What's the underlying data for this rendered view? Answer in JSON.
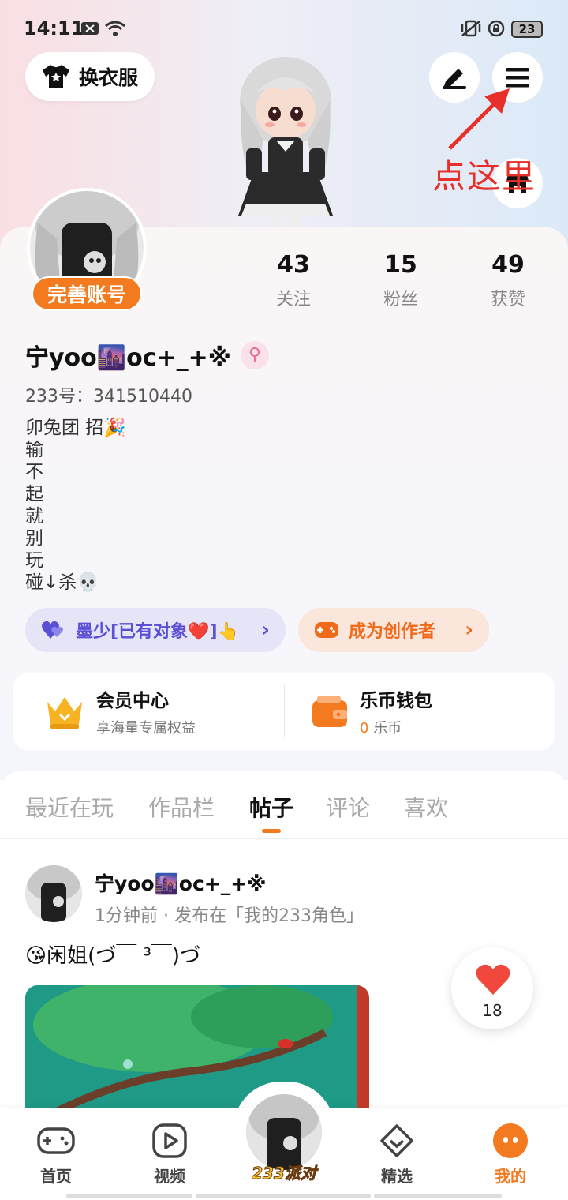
{
  "status_bar": {
    "time": "14:11",
    "battery": "23"
  },
  "header": {
    "outfit_button_label": "换衣服",
    "annotation_text": "点这里"
  },
  "profile": {
    "complete_account_label": "完善账号",
    "stats": [
      {
        "value": "43",
        "label": "关注"
      },
      {
        "value": "15",
        "label": "粉丝"
      },
      {
        "value": "49",
        "label": "获赞"
      }
    ],
    "username": "宁yoo🌆oc+_+※",
    "gender_symbol": "⚲",
    "user_id": "233号：341510440",
    "bio": "卯兔团 招🎉\n输\n不\n起\n就\n别\n玩\n碰↓杀💀",
    "relation_tag": "墨少[已有对象❤️]👆",
    "creator_tag": "成为创作者"
  },
  "member_card": {
    "member_title": "会员中心",
    "member_sub": "享海量专属权益",
    "wallet_title": "乐币钱包",
    "wallet_amount": "0",
    "wallet_unit": "乐币"
  },
  "tabs": [
    "最近在玩",
    "作品栏",
    "帖子",
    "评论",
    "喜欢"
  ],
  "active_tab": "帖子",
  "post": {
    "author": "宁yoo🌆oc+_+※",
    "meta": "1分钟前 · 发布在「我的233角色」",
    "text": "😘闲姐(づ￣ ³￣)づ",
    "like_count": "18"
  },
  "bottom_nav": {
    "items": [
      {
        "label": "首页",
        "icon": "gamepad-icon"
      },
      {
        "label": "视频",
        "icon": "play-icon"
      },
      {
        "label": "233派对",
        "icon": "avatar"
      },
      {
        "label": "精选",
        "icon": "heart-chat-icon"
      },
      {
        "label": "我的",
        "icon": "profile-face-icon"
      }
    ]
  },
  "colors": {
    "accent": "#f47a1f",
    "annotation": "#e8302b",
    "relation_tag": "#5b4fd6"
  }
}
